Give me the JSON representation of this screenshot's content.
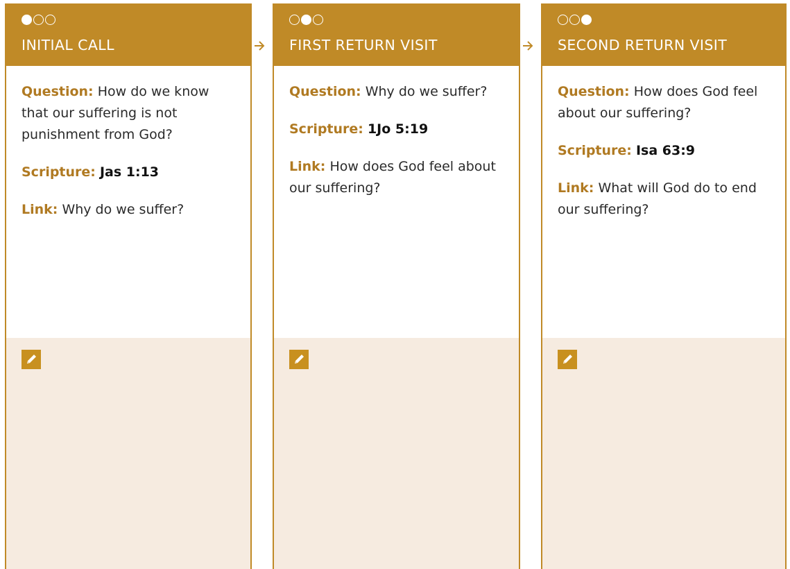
{
  "accent_color": "#c08a27",
  "notes_background": "#f6ebe0",
  "columns": [
    {
      "step_filled": 1,
      "title": "INITIAL CALL",
      "question_label": "Question:",
      "question": "How do we know that our suffering is not punishment from God?",
      "scripture_label": "Scripture:",
      "scripture": "Jas 1:13",
      "link_label": "Link:",
      "link": "Why do we suffer?",
      "notes_icon": "pencil-icon"
    },
    {
      "step_filled": 2,
      "title": "FIRST RETURN VISIT",
      "question_label": "Question:",
      "question": "Why do we suffer?",
      "scripture_label": "Scripture:",
      "scripture": "1Jo 5:19",
      "link_label": "Link:",
      "link": "How does God feel about our suffering?",
      "notes_icon": "pencil-icon"
    },
    {
      "step_filled": 3,
      "title": "SECOND RETURN VISIT",
      "question_label": "Question:",
      "question": "How does God feel about our suffering?",
      "scripture_label": "Scripture:",
      "scripture": "Isa 63:9",
      "link_label": "Link:",
      "link": "What will God do to end our suffering?",
      "notes_icon": "pencil-icon"
    }
  ],
  "connector_icon": "arrow-right-icon"
}
